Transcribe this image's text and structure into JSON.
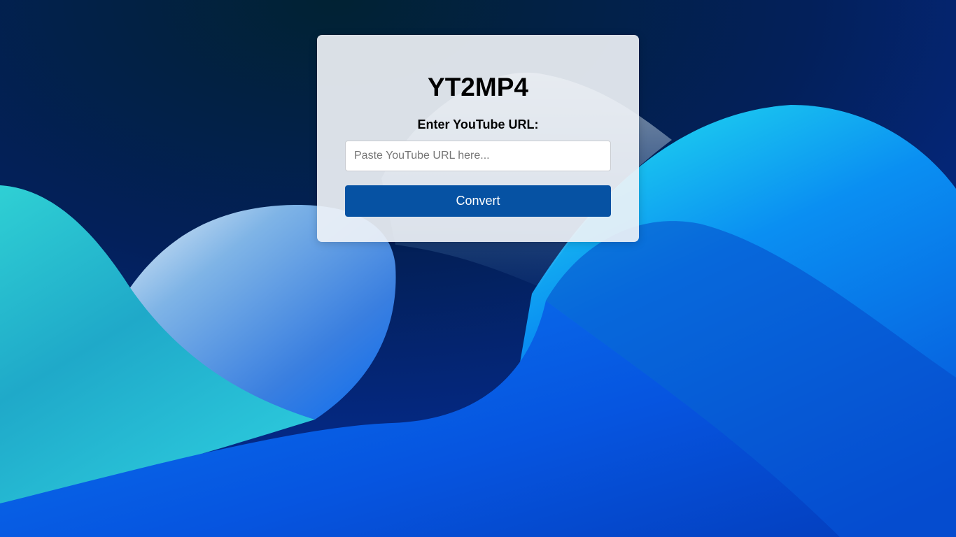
{
  "app": {
    "title": "YT2MP4"
  },
  "form": {
    "url_label": "Enter YouTube URL:",
    "url_value": "",
    "url_placeholder": "Paste YouTube URL here...",
    "convert_label": "Convert"
  },
  "colors": {
    "button_bg": "#0652a3",
    "card_bg": "#eef1f5",
    "wallpaper_dark": "#041a44",
    "wallpaper_cyan": "#2fd4e0",
    "wallpaper_blue": "#0a6cf0"
  }
}
